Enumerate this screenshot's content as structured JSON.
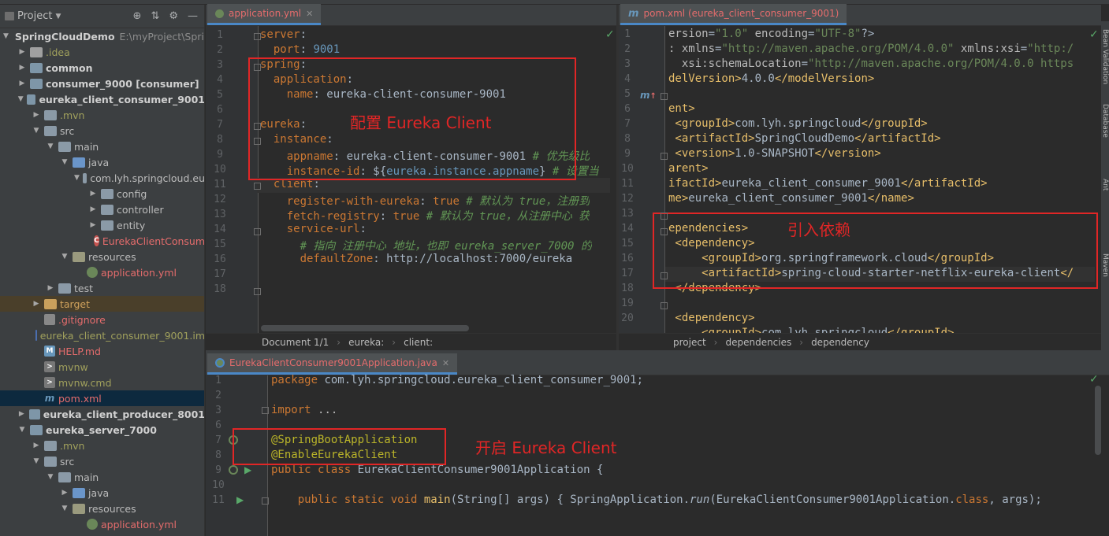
{
  "project_panel": {
    "title": "Project",
    "items": [
      {
        "label": "SpringCloudDemo",
        "extra": "E:\\myProject\\Sprin",
        "depth": 0,
        "arrow": "down",
        "icon": "module",
        "style": "bold"
      },
      {
        "label": ".idea",
        "depth": 1,
        "arrow": "right",
        "icon": "idea",
        "style": "olive"
      },
      {
        "label": "common",
        "depth": 1,
        "arrow": "right",
        "icon": "module",
        "style": "bold"
      },
      {
        "label": "consumer_9000 [consumer]",
        "depth": 1,
        "arrow": "right",
        "icon": "module",
        "style": "bold"
      },
      {
        "label": "eureka_client_consumer_9001",
        "depth": 1,
        "arrow": "down",
        "icon": "module",
        "style": "bold"
      },
      {
        "label": ".mvn",
        "depth": 2,
        "arrow": "right",
        "icon": "folder",
        "style": "olive"
      },
      {
        "label": "src",
        "depth": 2,
        "arrow": "down",
        "icon": "folder",
        "style": "normal"
      },
      {
        "label": "main",
        "depth": 3,
        "arrow": "down",
        "icon": "folder",
        "style": "normal"
      },
      {
        "label": "java",
        "depth": 4,
        "arrow": "down",
        "icon": "src",
        "style": "normal"
      },
      {
        "label": "com.lyh.springcloud.eu",
        "depth": 5,
        "arrow": "down",
        "icon": "folder",
        "style": "normal"
      },
      {
        "label": "config",
        "depth": 6,
        "arrow": "right",
        "icon": "folder",
        "style": "normal"
      },
      {
        "label": "controller",
        "depth": 6,
        "arrow": "right",
        "icon": "folder",
        "style": "normal"
      },
      {
        "label": "entity",
        "depth": 6,
        "arrow": "right",
        "icon": "folder",
        "style": "normal"
      },
      {
        "label": "EurekaClientConsum",
        "depth": 6,
        "arrow": "",
        "icon": "java",
        "style": "red"
      },
      {
        "label": "resources",
        "depth": 4,
        "arrow": "down",
        "icon": "res",
        "style": "normal"
      },
      {
        "label": "application.yml",
        "depth": 5,
        "arrow": "",
        "icon": "spring",
        "style": "red"
      },
      {
        "label": "test",
        "depth": 3,
        "arrow": "right",
        "icon": "folder",
        "style": "normal"
      },
      {
        "label": "target",
        "depth": 2,
        "arrow": "right",
        "icon": "target",
        "style": "orange",
        "row_style": "target"
      },
      {
        "label": ".gitignore",
        "depth": 2,
        "arrow": "",
        "icon": "git",
        "style": "red"
      },
      {
        "label": "eureka_client_consumer_9001.im",
        "depth": 2,
        "arrow": "",
        "icon": "iml",
        "style": "olive"
      },
      {
        "label": "HELP.md",
        "depth": 2,
        "arrow": "",
        "icon": "md",
        "style": "red"
      },
      {
        "label": "mvnw",
        "depth": 2,
        "arrow": "",
        "icon": "sh",
        "style": "olive"
      },
      {
        "label": "mvnw.cmd",
        "depth": 2,
        "arrow": "",
        "icon": "sh",
        "style": "olive"
      },
      {
        "label": "pom.xml",
        "depth": 2,
        "arrow": "",
        "icon": "m",
        "style": "red",
        "row_style": "selected"
      },
      {
        "label": "eureka_client_producer_8001",
        "depth": 1,
        "arrow": "right",
        "icon": "module",
        "style": "bold"
      },
      {
        "label": "eureka_server_7000",
        "depth": 1,
        "arrow": "down",
        "icon": "module",
        "style": "bold"
      },
      {
        "label": ".mvn",
        "depth": 2,
        "arrow": "right",
        "icon": "folder",
        "style": "olive"
      },
      {
        "label": "src",
        "depth": 2,
        "arrow": "down",
        "icon": "folder",
        "style": "normal"
      },
      {
        "label": "main",
        "depth": 3,
        "arrow": "down",
        "icon": "folder",
        "style": "normal"
      },
      {
        "label": "java",
        "depth": 4,
        "arrow": "right",
        "icon": "src",
        "style": "normal"
      },
      {
        "label": "resources",
        "depth": 4,
        "arrow": "down",
        "icon": "res",
        "style": "normal"
      },
      {
        "label": "application.yml",
        "depth": 5,
        "arrow": "",
        "icon": "spring",
        "style": "red"
      }
    ]
  },
  "yml_editor": {
    "tab": "application.yml",
    "line_numbers": [
      "1",
      "2",
      "3",
      "4",
      "5",
      "6",
      "7",
      "8",
      "9",
      "10",
      "11",
      "12",
      "13",
      "14",
      "15",
      "16",
      "17",
      "18"
    ],
    "lines": [
      [
        [
          "k-key",
          "server"
        ],
        [
          "",
          ": "
        ]
      ],
      [
        [
          "",
          "  "
        ],
        [
          "k-key",
          "port"
        ],
        [
          "",
          ": "
        ],
        [
          "k-num",
          "9001"
        ]
      ],
      [
        [
          "k-key",
          "spring"
        ],
        [
          "",
          ":"
        ]
      ],
      [
        [
          "",
          "  "
        ],
        [
          "k-key",
          "application"
        ],
        [
          "",
          ":"
        ]
      ],
      [
        [
          "",
          "    "
        ],
        [
          "k-key",
          "name"
        ],
        [
          "",
          ": eureka-client-consumer-9001"
        ]
      ],
      [
        [
          "",
          ""
        ]
      ],
      [
        [
          "k-key",
          "eureka"
        ],
        [
          "",
          ":"
        ]
      ],
      [
        [
          "",
          "  "
        ],
        [
          "k-key",
          "instance"
        ],
        [
          "",
          ":"
        ]
      ],
      [
        [
          "",
          "    "
        ],
        [
          "k-key",
          "appname"
        ],
        [
          "",
          ": eureka-client-consumer-9001 "
        ],
        [
          "k-com",
          "# 优先级比"
        ]
      ],
      [
        [
          "",
          "    "
        ],
        [
          "k-key",
          "instance-id"
        ],
        [
          "",
          ": ${"
        ],
        [
          "k-num",
          "eureka.instance.appname"
        ],
        [
          "",
          "} "
        ],
        [
          "k-com",
          "# 设置当"
        ]
      ],
      [
        [
          "",
          "  "
        ],
        [
          "k-key",
          "client"
        ],
        [
          "",
          ":"
        ]
      ],
      [
        [
          "",
          "    "
        ],
        [
          "k-key",
          "register-with-eureka"
        ],
        [
          "",
          ": "
        ],
        [
          "k-key",
          "true"
        ],
        [
          "k-com",
          " # 默认为 true，注册到"
        ]
      ],
      [
        [
          "",
          "    "
        ],
        [
          "k-key",
          "fetch-registry"
        ],
        [
          "",
          ": "
        ],
        [
          "k-key",
          "true"
        ],
        [
          "k-com",
          " # 默认为 true，从注册中心 获"
        ]
      ],
      [
        [
          "",
          "    "
        ],
        [
          "k-key",
          "service-url"
        ],
        [
          "",
          ":"
        ]
      ],
      [
        [
          "k-com",
          "      # 指向 注册中心 地址，也即 eureka_server_7000 的"
        ]
      ],
      [
        [
          "",
          "      "
        ],
        [
          "k-key",
          "defaultZone"
        ],
        [
          "",
          ": http://localhost:7000/eureka"
        ]
      ],
      [
        [
          "",
          ""
        ]
      ],
      [
        [
          "",
          ""
        ]
      ]
    ],
    "breadcrumb": [
      "Document 1/1",
      "eureka:",
      "client:"
    ]
  },
  "pom_editor": {
    "tab_m": "m",
    "tab": "pom.xml (eureka_client_consumer_9001)",
    "line_numbers": [
      "1",
      "2",
      "3",
      "4",
      "5",
      "6",
      "7",
      "8",
      "9",
      "10",
      "11",
      "12",
      "13",
      "14",
      "15",
      "16",
      "17",
      "18",
      "19",
      "20"
    ],
    "lines": [
      [
        [
          "k-attr",
          "ersion"
        ],
        [
          "",
          "="
        ],
        [
          "k-str",
          "\"1.0\""
        ],
        [
          "k-attr",
          " encoding"
        ],
        [
          "",
          "="
        ],
        [
          "k-str",
          "\"UTF-8\""
        ],
        [
          "",
          "?>"
        ]
      ],
      [
        [
          "k-attr",
          ": xmlns"
        ],
        [
          "",
          "="
        ],
        [
          "k-str",
          "\"http://maven.apache.org/POM/4.0.0\""
        ],
        [
          "k-attr",
          " xmlns:xsi"
        ],
        [
          "",
          "="
        ],
        [
          "k-str",
          "\"http:/"
        ]
      ],
      [
        [
          "k-attr",
          "  xsi:schemaLocation"
        ],
        [
          "",
          "="
        ],
        [
          "k-str",
          "\"http://maven.apache.org/POM/4.0.0 https"
        ]
      ],
      [
        [
          "k-tag",
          "delVersion>"
        ],
        [
          "",
          "4.0.0"
        ],
        [
          "k-tag",
          "</modelVersion>"
        ]
      ],
      [
        [
          "",
          ""
        ]
      ],
      [
        [
          "k-tag",
          "ent>"
        ]
      ],
      [
        [
          "k-tag",
          " <groupId>"
        ],
        [
          "",
          "com.lyh.springcloud"
        ],
        [
          "k-tag",
          "</groupId>"
        ]
      ],
      [
        [
          "k-tag",
          " <artifactId>"
        ],
        [
          "",
          "SpringCloudDemo"
        ],
        [
          "k-tag",
          "</artifactId>"
        ]
      ],
      [
        [
          "k-tag",
          " <version>"
        ],
        [
          "",
          "1.0-SNAPSHOT"
        ],
        [
          "k-tag",
          "</version>"
        ]
      ],
      [
        [
          "k-tag",
          "arent>"
        ]
      ],
      [
        [
          "k-tag",
          "ifactId>"
        ],
        [
          "",
          "eureka_client_consumer_9001"
        ],
        [
          "k-tag",
          "</artifactId>"
        ]
      ],
      [
        [
          "k-tag",
          "me>"
        ],
        [
          "",
          "eureka_client_consumer_9001"
        ],
        [
          "k-tag",
          "</name>"
        ]
      ],
      [
        [
          "",
          ""
        ]
      ],
      [
        [
          "k-tag",
          "ependencies>"
        ]
      ],
      [
        [
          "k-tag",
          " <dependency>"
        ]
      ],
      [
        [
          "k-tag",
          "     <groupId>"
        ],
        [
          "",
          "org.springframework.cloud"
        ],
        [
          "k-tag",
          "</groupId>"
        ]
      ],
      [
        [
          "k-tag",
          "     <artifactId>"
        ],
        [
          "",
          "spring-cloud-starter-netflix-eureka-client"
        ],
        [
          "k-tag",
          "</"
        ]
      ],
      [
        [
          "k-tag",
          " </dependency>"
        ]
      ],
      [
        [
          "",
          ""
        ]
      ],
      [
        [
          "k-tag",
          " <dependency>"
        ]
      ],
      [
        [
          "k-tag",
          "     <groupId>"
        ],
        [
          "",
          "com.lyh.springcloud"
        ],
        [
          "k-tag",
          "</groupId>"
        ]
      ]
    ],
    "breadcrumb": [
      "project",
      "dependencies",
      "dependency"
    ]
  },
  "java_editor": {
    "tab": "EurekaClientConsumer9001Application.java",
    "line_numbers": [
      "1",
      "2",
      "3",
      "6",
      "7",
      "8",
      "9",
      "10",
      "11"
    ],
    "lines": [
      [
        [
          "k-kw",
          "package "
        ],
        [
          "",
          "com.lyh.springcloud.eureka_client_consumer_9001;"
        ]
      ],
      [
        [
          "",
          ""
        ]
      ],
      [
        [
          "k-kw",
          "import "
        ],
        [
          "k-attr",
          "..."
        ]
      ],
      [
        [
          "",
          ""
        ]
      ],
      [
        [
          "k-anno",
          "@SpringBootApplication"
        ]
      ],
      [
        [
          "k-anno",
          "@EnableEurekaClient"
        ]
      ],
      [
        [
          "k-kw",
          "public class "
        ],
        [
          "",
          "EurekaClientConsumer9001Application {"
        ]
      ],
      [
        [
          "",
          ""
        ]
      ],
      [
        [
          "k-kw",
          "    public static void "
        ],
        [
          "k-tag",
          "main"
        ],
        [
          "",
          "(String[] args) { SpringApplication."
        ],
        [
          "k-ital",
          "run"
        ],
        [
          "",
          "(EurekaClientConsumer9001Application."
        ],
        [
          "k-kw",
          "class"
        ],
        [
          "",
          ", args);"
        ]
      ]
    ]
  },
  "annotations": {
    "yml": "配置 Eureka Client",
    "pom": "引入依赖",
    "java": "开启 Eureka Client"
  },
  "right_strip": [
    "Bean Validation",
    "Database",
    "Ant",
    "Maven"
  ],
  "colors": {
    "annotation": "#e12626",
    "accent": "#4a88c7"
  }
}
